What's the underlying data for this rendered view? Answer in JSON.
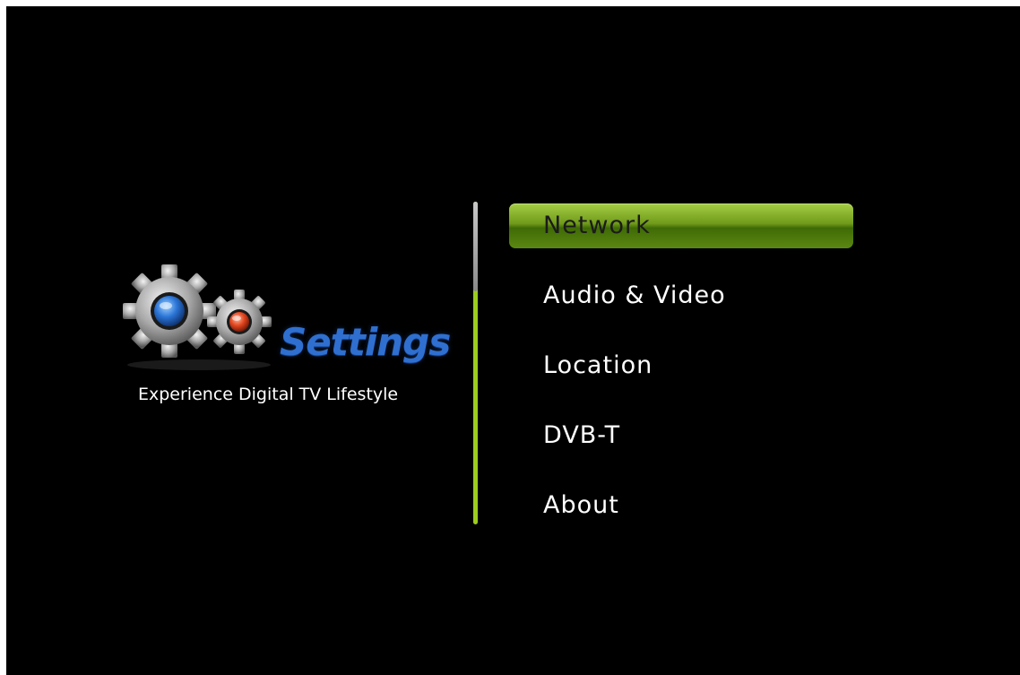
{
  "logo": {
    "title": "Settings",
    "tagline": "Experience Digital TV Lifestyle",
    "icon": "gears-icon"
  },
  "menu": {
    "selected_index": 0,
    "items": [
      {
        "label": "Network"
      },
      {
        "label": "Audio & Video"
      },
      {
        "label": "Location"
      },
      {
        "label": "DVB-T"
      },
      {
        "label": "About"
      }
    ]
  },
  "colors": {
    "background": "#000000",
    "accent": "#9ccc1f",
    "logo_text": "#2f6fd0",
    "menu_text": "#ffffff"
  },
  "scroll": {
    "position_fraction": 0
  }
}
